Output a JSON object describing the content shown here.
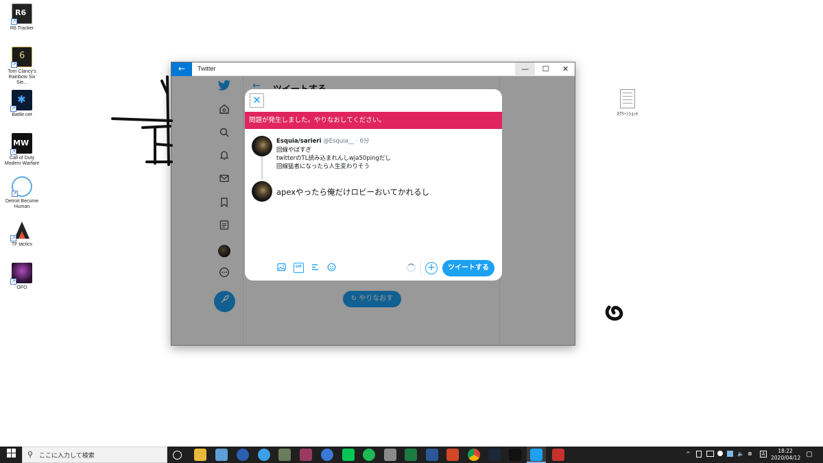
{
  "desktop": {
    "icons": [
      {
        "label": "R6 Tracker",
        "icon": "r6-tracker-icon"
      },
      {
        "label": "Tom Clancy's Rainbow Six Sie...",
        "icon": "rainbow-six-icon"
      },
      {
        "label": "Battle.net",
        "icon": "battlenet-icon"
      },
      {
        "label": "Call of Duty Modern Warfare",
        "icon": "call-of-duty-icon"
      },
      {
        "label": "Detroit Become Human",
        "icon": "detroit-icon"
      },
      {
        "label": "TF tactics",
        "icon": "tf-tactics-icon"
      },
      {
        "label": "OFO",
        "icon": "ofo-icon"
      }
    ],
    "file": {
      "label": "ｽｸﾘｰﾝｼｮｯﾄ",
      "icon": "text-file-icon"
    }
  },
  "window": {
    "title": "Twitter",
    "controls": {
      "minimize": "—",
      "maximize": "☐",
      "close": "✕"
    }
  },
  "background_page": {
    "header_title": "ツイートする",
    "retry_label": "やりなおす"
  },
  "dialog": {
    "error_message": "問題が発生しました。やりなおしてください。",
    "original_tweet": {
      "name": "Esquia/sarieri",
      "handle": "@Esquia__",
      "separator": "·",
      "time": "6分",
      "lines": [
        "回線やばすぎ",
        "twitterのTL読み込まれんしwja50pingだし",
        "回線猛者になったら人生変わりそう"
      ]
    },
    "reply_text": "apexやったら俺だけロビーおいてかれるし",
    "toolbar": {
      "gif_label": "GIF",
      "tweet_button": "ツイートする"
    }
  },
  "taskbar": {
    "search_placeholder": "ここに入力して検索",
    "clock_time": "18:22",
    "clock_date": "2020/04/12",
    "ime_indicator": "A"
  },
  "colors": {
    "twitter_blue": "#1da1f2",
    "error_red": "#e0245e",
    "titlebar_blue": "#0078d7",
    "taskbar": "#1f1f1f"
  }
}
